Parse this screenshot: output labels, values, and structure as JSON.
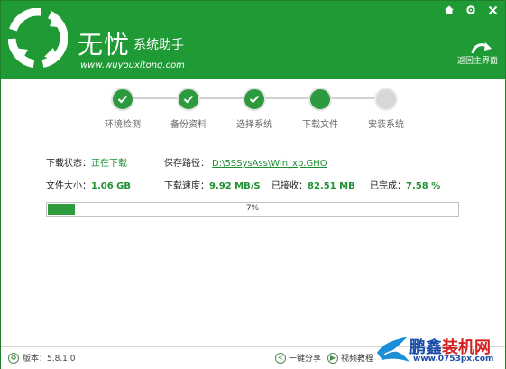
{
  "header": {
    "brand_title": "无忧",
    "brand_sub": "系统助手",
    "url": "www.wuyouxitong.com",
    "back_label": "返回主界面"
  },
  "steps": [
    {
      "label": "环境检测",
      "state": "done"
    },
    {
      "label": "备份资料",
      "state": "done"
    },
    {
      "label": "选择系统",
      "state": "done"
    },
    {
      "label": "下载文件",
      "state": "current"
    },
    {
      "label": "安装系统",
      "state": "pending"
    }
  ],
  "info": {
    "status_label": "下载状态：",
    "status_value": "正在下载",
    "path_label": "保存路径：",
    "path_value": "D:\\5SSysAss\\Win_xp.GHO",
    "size_label": "文件大小：",
    "size_value": "1.06 GB",
    "speed_label": "下载速度：",
    "speed_value": "9.92 MB/S",
    "received_label": "已接收：",
    "received_value": "82.51 MB",
    "done_label": "已完成：",
    "done_value": "7.58 %"
  },
  "progress": {
    "value": 7,
    "text": "7%"
  },
  "footer": {
    "version": "版本：5.8.1.0",
    "share": "一键分享",
    "video": "视频教程"
  },
  "watermark": {
    "title_part1": "鹏鑫",
    "title_part2": "装机网",
    "url": "www.0753px.com"
  },
  "colors": {
    "brand_green": "#1f9a35",
    "accent_green": "#2c9a3e",
    "watermark_blue": "#1a4ca8",
    "watermark_red": "#d32020"
  }
}
